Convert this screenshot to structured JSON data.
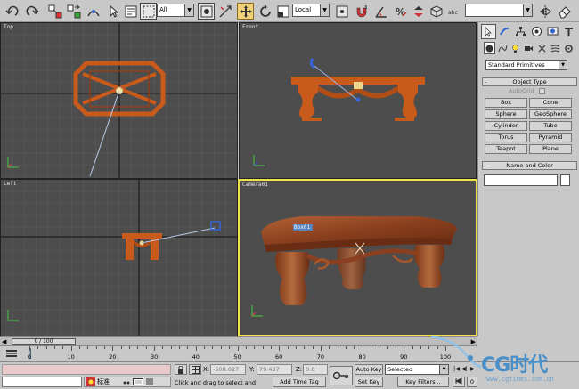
{
  "toolbar": {
    "selection_filter": "All",
    "coord_system": "Local",
    "named_selection_placeholder": ""
  },
  "viewports": {
    "top": {
      "label": "Top"
    },
    "front": {
      "label": "Front"
    },
    "left": {
      "label": "Left"
    },
    "camera": {
      "label": "Camera01",
      "object_tag": "Box01"
    }
  },
  "command_panel": {
    "category": "Standard Primitives",
    "object_type": {
      "title": "Object Type",
      "autogrid_label": "AutoGrid",
      "buttons": [
        "Box",
        "Cone",
        "Sphere",
        "GeoSphere",
        "Cylinder",
        "Tube",
        "Torus",
        "Pyramid",
        "Teapot",
        "Plane"
      ]
    },
    "name_and_color": {
      "title": "Name and Color",
      "name_value": ""
    },
    "rollout_sign": "-"
  },
  "timeline": {
    "frame_display": "0 / 100",
    "ticks": [
      "0",
      "10",
      "20",
      "30",
      "40",
      "50",
      "60",
      "70",
      "80",
      "90",
      "100"
    ]
  },
  "status": {
    "ime_text": "标准",
    "x_label": "X:",
    "x_value": "-508.027",
    "y_label": "Y:",
    "y_value": "79.437",
    "z_label": "Z:",
    "z_value": "0.0",
    "prompt": "Click and drag to select and move",
    "add_time_tag": "Add Time Tag",
    "auto_key": "Auto Key",
    "set_key": "Set Key",
    "selected": "Selected",
    "key_filters": "Key Filters...",
    "frame_field": "0"
  },
  "logo": {
    "brand": "CG时代",
    "url": "www.cgtimes.com.cn"
  }
}
